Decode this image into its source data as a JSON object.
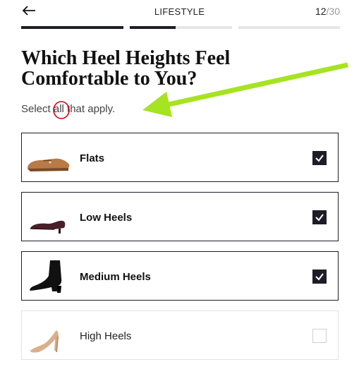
{
  "header": {
    "title": "LIFESTYLE",
    "progress_current": "12",
    "progress_total": "/30",
    "progress_segments": [
      1.0,
      0.45,
      0.0
    ]
  },
  "question": {
    "title": "Which Heel Heights Feel Comfortable to You?",
    "subtitle_before": "Select ",
    "subtitle_em": "all",
    "subtitle_after": " that apply."
  },
  "options": [
    {
      "label": "Flats",
      "selected": true,
      "icon": "flat-shoe-icon"
    },
    {
      "label": "Low Heels",
      "selected": true,
      "icon": "low-heel-shoe-icon"
    },
    {
      "label": "Medium Heels",
      "selected": true,
      "icon": "ankle-boot-icon"
    },
    {
      "label": "High Heels",
      "selected": false,
      "icon": "high-heel-shoe-icon"
    }
  ],
  "colors": {
    "accent": "#1d1d27",
    "annotation_arrow": "#a6e321",
    "annotation_circle": "#d0021b"
  }
}
